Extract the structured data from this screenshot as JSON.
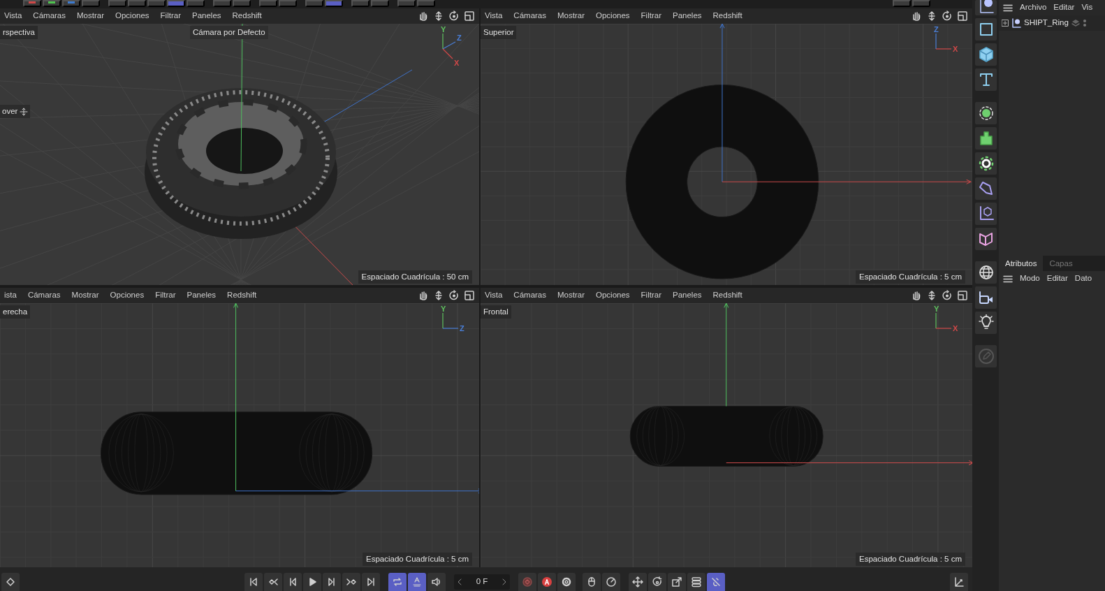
{
  "top_toolbar": {
    "groups": [
      {
        "buttons": [
          {
            "color": "#d04848",
            "on": false
          },
          {
            "color": "#4fc34f",
            "on": false
          },
          {
            "color": "#3d7bd0",
            "on": false
          },
          {
            "on": false
          }
        ]
      },
      {
        "buttons": [
          {
            "on": false
          },
          {
            "on": false
          },
          {
            "on": false
          },
          {
            "on": true
          },
          {
            "on": false
          }
        ]
      },
      {
        "buttons": [
          {
            "on": false
          },
          {
            "on": false
          }
        ]
      },
      {
        "buttons": [
          {
            "on": false
          },
          {
            "on": false
          }
        ]
      },
      {
        "buttons": [
          {
            "on": false
          },
          {
            "on": true
          }
        ]
      },
      {
        "buttons": [
          {
            "on": false
          },
          {
            "on": false
          }
        ]
      },
      {
        "buttons": [
          {
            "on": false
          },
          {
            "on": false
          }
        ]
      },
      {
        "buttons": [
          {
            "on": false
          },
          {
            "on": false
          }
        ]
      }
    ]
  },
  "viewports": [
    {
      "kind": "perspective",
      "menu": [
        "Vista",
        "Cámaras",
        "Mostrar",
        "Opciones",
        "Filtrar",
        "Paneles",
        "Redshift"
      ],
      "name": "rspectiva",
      "camera": "Cámara por Defecto",
      "overlay_label": "over",
      "grid_spacing": "Espaciado Cuadrícula : 50 cm",
      "gizmo": [
        {
          "label": "Y",
          "color": "#5fc35f"
        },
        {
          "label": "Z",
          "color": "#4a7fd8"
        },
        {
          "label": "X",
          "color": "#d04848"
        }
      ]
    },
    {
      "kind": "top",
      "menu": [
        "Vista",
        "Cámaras",
        "Mostrar",
        "Opciones",
        "Filtrar",
        "Paneles",
        "Redshift"
      ],
      "name": "Superior",
      "grid_spacing": "Espaciado Cuadrícula : 5 cm",
      "gizmo": [
        {
          "label": "Z",
          "color": "#4a7fd8"
        },
        {
          "label": "X",
          "color": "#d04848"
        }
      ]
    },
    {
      "kind": "side",
      "menu": [
        "ista",
        "Cámaras",
        "Mostrar",
        "Opciones",
        "Filtrar",
        "Paneles",
        "Redshift"
      ],
      "name": "erecha",
      "grid_spacing": "Espaciado Cuadrícula : 5 cm",
      "gizmo": [
        {
          "label": "Y",
          "color": "#5fc35f"
        },
        {
          "label": "Z",
          "color": "#4a7fd8"
        }
      ]
    },
    {
      "kind": "front",
      "menu": [
        "Vista",
        "Cámaras",
        "Mostrar",
        "Opciones",
        "Filtrar",
        "Paneles",
        "Redshift"
      ],
      "name": "Frontal",
      "grid_spacing": "Espaciado Cuadrícula : 5 cm",
      "gizmo": [
        {
          "label": "Y",
          "color": "#5fc35f"
        },
        {
          "label": "X",
          "color": "#d04848"
        }
      ]
    }
  ],
  "object_manager": {
    "menu": [
      "Archivo",
      "Editar",
      "Vis"
    ],
    "objects": [
      {
        "name": "SHIPT_Ring",
        "expanded": false
      }
    ]
  },
  "attributes": {
    "tabs": [
      {
        "label": "Atributos",
        "selected": true
      },
      {
        "label": "Capas",
        "selected": false
      }
    ],
    "menu": [
      "Modo",
      "Editar",
      "Dato"
    ]
  },
  "bottom_bar": {
    "groups": [
      {
        "items": [
          {
            "kind": "keyframe",
            "on": false
          }
        ]
      },
      {
        "items": [
          {
            "kind": "first",
            "on": false
          },
          {
            "kind": "prevkey",
            "on": false
          },
          {
            "kind": "prevframe",
            "on": false
          },
          {
            "kind": "play",
            "on": false
          },
          {
            "kind": "nextframe",
            "on": false
          },
          {
            "kind": "nextkey",
            "on": false
          },
          {
            "kind": "last",
            "on": false
          }
        ]
      },
      {
        "items": [
          {
            "kind": "loop",
            "on": true
          },
          {
            "kind": "auto",
            "on": true
          },
          {
            "kind": "sound",
            "on": false
          }
        ]
      },
      {
        "items": [
          {
            "kind": "frame",
            "value": "0 F"
          }
        ]
      },
      {
        "items": [
          {
            "kind": "record",
            "on": false
          },
          {
            "kind": "autokey",
            "on": false
          },
          {
            "kind": "gear",
            "on": false
          }
        ]
      },
      {
        "items": [
          {
            "kind": "mouse",
            "on": false
          },
          {
            "kind": "dial",
            "on": false
          }
        ]
      },
      {
        "items": [
          {
            "kind": "move",
            "on": false
          },
          {
            "kind": "rotate",
            "on": false
          },
          {
            "kind": "scale",
            "on": false
          },
          {
            "kind": "stack",
            "on": false
          },
          {
            "kind": "snap",
            "on": true
          }
        ]
      },
      {
        "items": [
          {
            "kind": "axis",
            "on": false
          }
        ]
      }
    ]
  }
}
